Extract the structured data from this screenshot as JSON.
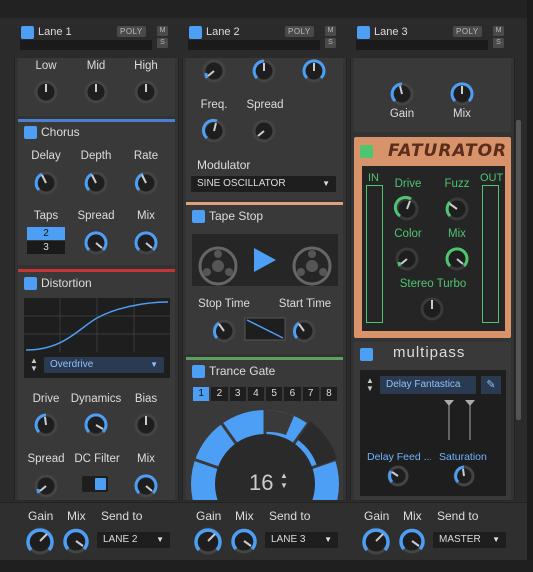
{
  "lanes": [
    {
      "title": "Lane 1",
      "poly": "POLY",
      "m": "M",
      "s": "S",
      "send_to": "LANE 2"
    },
    {
      "title": "Lane 2",
      "poly": "POLY",
      "m": "M",
      "s": "S",
      "send_to": "LANE 3"
    },
    {
      "title": "Lane 3",
      "poly": "POLY",
      "m": "M",
      "s": "S",
      "send_to": "MASTER"
    }
  ],
  "lane1": {
    "eq": {
      "low": "Low",
      "mid": "Mid",
      "high": "High"
    },
    "chorus": {
      "title": "Chorus",
      "delay": "Delay",
      "depth": "Depth",
      "rate": "Rate",
      "taps": "Taps",
      "taps_options": [
        "2",
        "3"
      ],
      "spread": "Spread",
      "mix": "Mix"
    },
    "distortion": {
      "title": "Distortion",
      "mode": "Overdrive",
      "drive": "Drive",
      "dynamics": "Dynamics",
      "bias": "Bias",
      "spread": "Spread",
      "dc_filter": "DC Filter",
      "mix": "Mix"
    }
  },
  "lane2": {
    "filter": {
      "freq": "Freq.",
      "spread": "Spread",
      "modulator": "Modulator",
      "modulator_value": "SINE OSCILLATOR"
    },
    "tape_stop": {
      "title": "Tape Stop",
      "stop_time": "Stop Time",
      "start_time": "Start Time"
    },
    "trance_gate": {
      "title": "Trance Gate",
      "steps": [
        "1",
        "2",
        "3",
        "4",
        "5",
        "6",
        "7",
        "8"
      ],
      "active_step": "1",
      "value": "16"
    }
  },
  "lane3": {
    "top": {
      "gain": "Gain",
      "mix": "Mix"
    },
    "faturator": {
      "title": "FATURATOR",
      "in": "IN",
      "out": "OUT",
      "drive": "Drive",
      "fuzz": "Fuzz",
      "color": "Color",
      "mix": "Mix",
      "stereo": "Stereo Turbo"
    },
    "multipass": {
      "title": "multipass",
      "preset": "Delay Fantastica",
      "band1": "Delay Feed ...",
      "band2": "Saturation"
    }
  },
  "mixer": {
    "gain": "Gain",
    "mix": "Mix",
    "send_to": "Send to"
  },
  "colors": {
    "accent": "#4d9ef5",
    "green": "#4ec56f",
    "chorus": "#4d7fd0",
    "distortion": "#c63434",
    "tape": "#e0a080",
    "trance": "#5fa060",
    "faturator": "#d9936a"
  }
}
